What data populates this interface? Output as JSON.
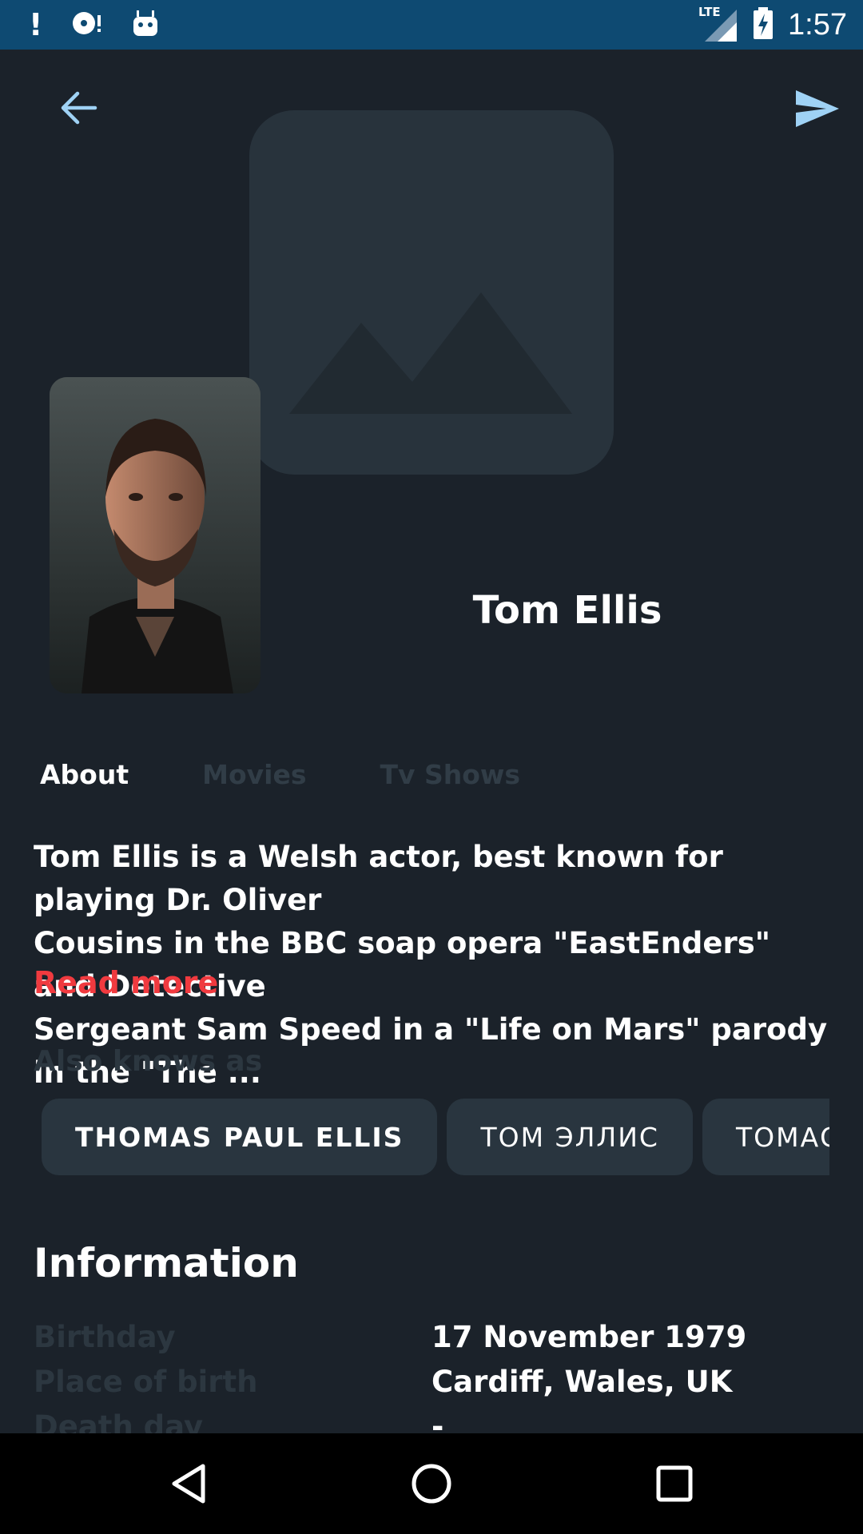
{
  "status_bar": {
    "time": "1:57",
    "network": "LTE",
    "icons": [
      "alert-icon",
      "disc-icon",
      "android-icon",
      "signal-icon",
      "battery-charging-icon"
    ]
  },
  "header": {
    "back_icon": "arrow-left-icon",
    "share_icon": "send-icon",
    "backdrop_icon": "image-placeholder-icon"
  },
  "person": {
    "name": "Tom Ellis",
    "poster_icon": "portrait-photo"
  },
  "tabs": [
    {
      "label": "About",
      "active": true
    },
    {
      "label": "Movies",
      "active": false
    },
    {
      "label": "Tv Shows",
      "active": false
    }
  ],
  "about": {
    "bio_line1": "Tom Ellis is a Welsh actor, best known for playing Dr. Oliver",
    "bio_line2": "Cousins in the BBC soap opera \"EastEnders\" and Detective",
    "bio_line3": "Sergeant Sam Speed in a \"Life on Mars\" parody in the \"The ...",
    "read_more": "Read more"
  },
  "also_known_as": {
    "label": "Also knows as",
    "names": [
      "THOMAS PAUL ELLIS",
      "ТОМ ЭЛЛИС",
      "ТОМАС Д"
    ]
  },
  "information": {
    "title": "Information",
    "rows": [
      {
        "key": "Birthday",
        "value": "17 November 1979"
      },
      {
        "key": "Place of birth",
        "value": "Cardiff, Wales, UK"
      },
      {
        "key": "Death day",
        "value": "-"
      }
    ]
  },
  "nav_bar": {
    "icons": [
      "back-triangle-icon",
      "home-circle-icon",
      "recents-square-icon"
    ]
  },
  "colors": {
    "background": "#1b222a",
    "status_bar": "#0e4a72",
    "accent_red": "#f03a3f",
    "accent_blue": "#9fd2f5",
    "muted": "#2c3740",
    "chip": "#29353f"
  }
}
